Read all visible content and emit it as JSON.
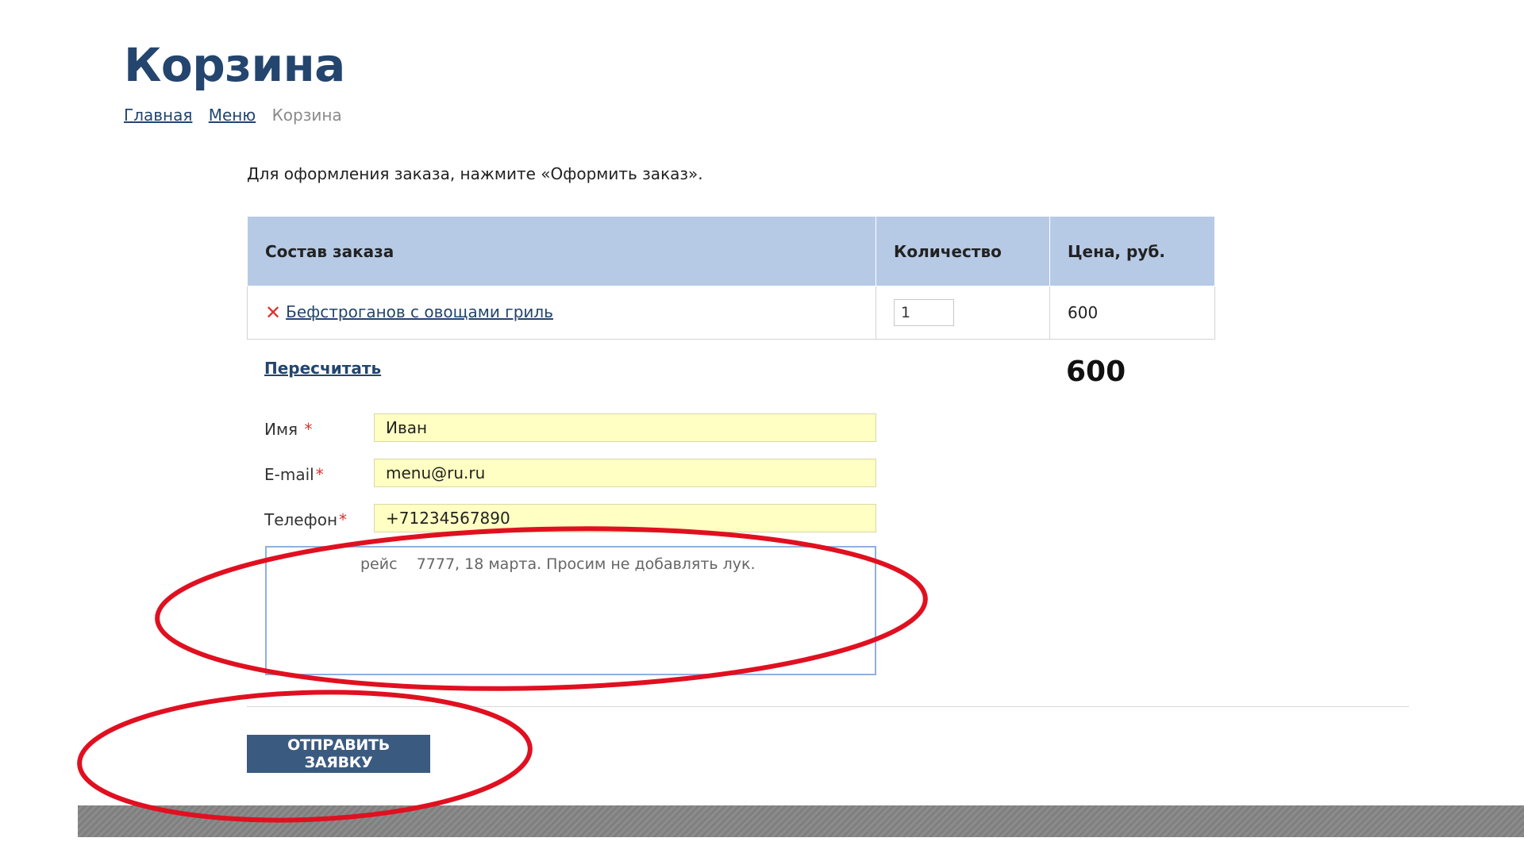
{
  "page_title": "Корзина",
  "breadcrumb": {
    "home": "Главная",
    "menu": "Меню",
    "current": "Корзина"
  },
  "instruction": "Для оформления заказа, нажмите «Оформить заказ».",
  "table": {
    "headers": [
      "Состав заказа",
      "Количество",
      "Цена, руб."
    ],
    "rows": [
      {
        "name": "Бефстроганов с овощами гриль",
        "quantity": "1",
        "price": "600"
      }
    ]
  },
  "recalc_label": "Пересчитать",
  "total": "600",
  "form": {
    "name_label": "Имя",
    "name_value": "Иван",
    "email_label": "E-mail",
    "email_value": "menu@ru.ru",
    "phone_label": "Телефон",
    "phone_value": "+71234567890",
    "required_mark": "*",
    "comment_value": "рейс    7777, 18 марта. Просим не добавлять лук."
  },
  "submit_label": "ОТПРАВИТЬ ЗАЯВКУ",
  "colors": {
    "accent": "#23456e",
    "header_bg": "#b6cae6",
    "input_bg": "#ffffc3",
    "button_bg": "#3b5a80",
    "annotation": "#e01020"
  },
  "icons": {
    "remove": "close-x-icon"
  }
}
